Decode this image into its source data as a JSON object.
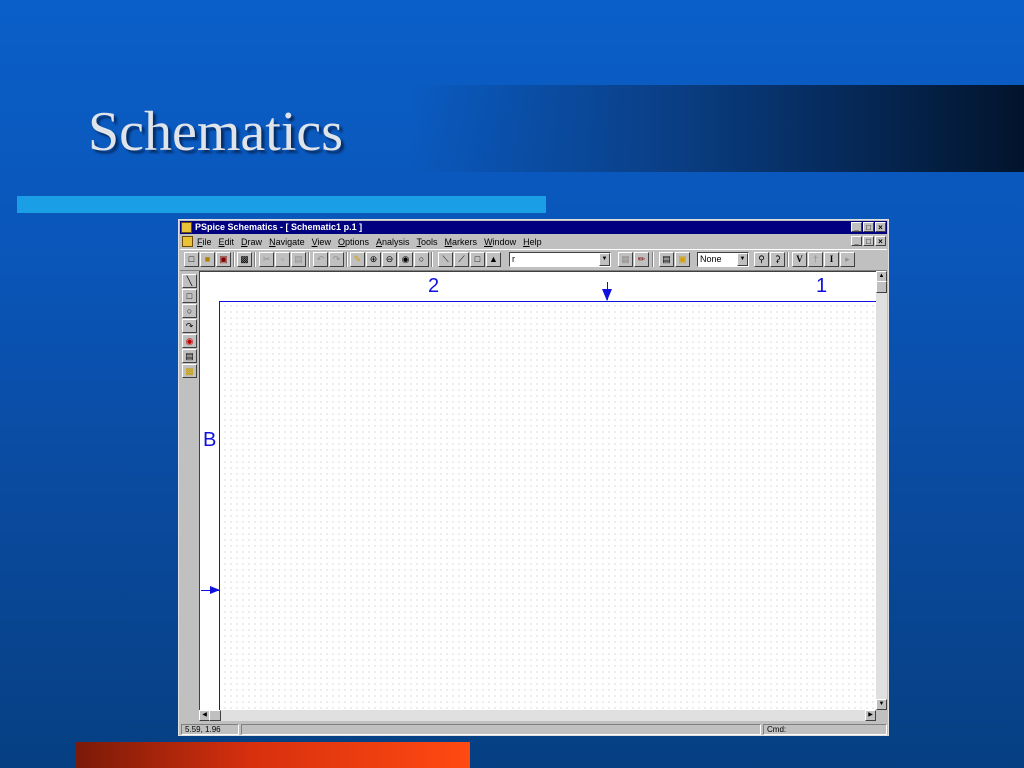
{
  "slide": {
    "title": "Schematics"
  },
  "window": {
    "title": "PSpice Schematics - [ Schematic1  p.1   ]",
    "controls": [
      "_",
      "□",
      "×"
    ]
  },
  "menu": {
    "items": [
      "File",
      "Edit",
      "Draw",
      "Navigate",
      "View",
      "Options",
      "Analysis",
      "Tools",
      "Markers",
      "Window",
      "Help"
    ]
  },
  "toolbar": {
    "part_combo_value": "r",
    "marker_combo_value": "None",
    "voltage_label": "V",
    "current_label": "I"
  },
  "canvas": {
    "zone_labels": {
      "top_left": "2",
      "top_right": "1",
      "left": "B"
    }
  },
  "status": {
    "coords": "5.59, 1.96",
    "cmd_label": "Cmd:"
  },
  "colors": {
    "slide_background": "#0a55b8",
    "accent_bar": "#1a9ee6",
    "bottom_bar": "#d8300e",
    "title_bar": "#000080",
    "frame_blue": "#1010e0"
  }
}
